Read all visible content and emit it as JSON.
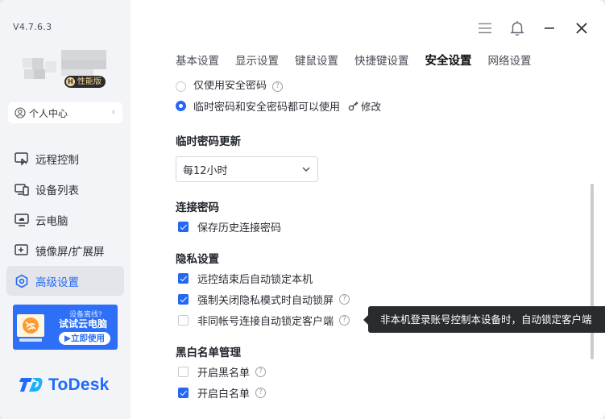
{
  "app": {
    "version": "V4.7.6.3",
    "badge": "性能版",
    "badge_letter": "H",
    "brand": "ToDesk"
  },
  "profile": {
    "label": "个人中心"
  },
  "sidebar": {
    "items": [
      {
        "label": "远程控制",
        "icon": "remote-control-icon",
        "active": false
      },
      {
        "label": "设备列表",
        "icon": "device-list-icon",
        "active": false
      },
      {
        "label": "云电脑",
        "icon": "cloud-pc-icon",
        "active": false
      },
      {
        "label": "镜像屏/扩展屏",
        "icon": "mirror-screen-icon",
        "active": false
      },
      {
        "label": "高级设置",
        "icon": "advanced-settings-icon",
        "active": true
      }
    ]
  },
  "promo": {
    "small": "设备离线?",
    "title": "试试云电脑",
    "cta": "立即使用"
  },
  "tabs": [
    "基本设置",
    "显示设置",
    "键鼠设置",
    "快捷键设置",
    "安全设置",
    "网络设置"
  ],
  "active_tab": "安全设置",
  "security": {
    "password_mode_partial": "仅使用安全密码",
    "password_mode_selected": "临时密码和安全密码都可以使用",
    "edit_label": "修改",
    "temp_update_title": "临时密码更新",
    "temp_update_value": "每12小时",
    "conn_pwd_title": "连接密码",
    "save_history": "保存历史连接密码",
    "privacy_title": "隐私设置",
    "lock_after_remote": "远控结束后自动锁定本机",
    "lock_on_privacy_close": "强制关闭隐私模式时自动锁屏",
    "lock_non_same_account": "非同帐号连接自动锁定客户端",
    "bw_title": "黑白名单管理",
    "enable_blacklist": "开启黑名单",
    "enable_whitelist": "开启白名单"
  },
  "tooltip": {
    "text": "非本机登录账号控制本设备时，自动锁定客户端"
  },
  "colors": {
    "accent": "#2468f2",
    "sidebar_bg": "#f3f4f7",
    "promo_bg": "#2d6ff6",
    "tooltip_bg": "#2a2b2e"
  }
}
